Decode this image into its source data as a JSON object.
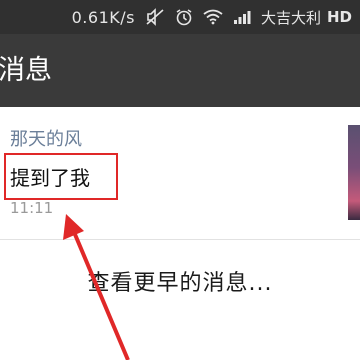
{
  "status_bar": {
    "speed": "0.61K/s",
    "icons": [
      "mute-icon",
      "alarm-icon",
      "wifi-icon",
      "signal-icon"
    ],
    "carrier": "大吉大利",
    "network": "HD"
  },
  "header": {
    "title": "消息"
  },
  "message": {
    "sender": "那天的风",
    "content": "提到了我",
    "time": "11:11"
  },
  "load_more": {
    "label": "查看更早的消息..."
  },
  "colors": {
    "highlight": "#e02828",
    "sender": "#6b7f99"
  }
}
